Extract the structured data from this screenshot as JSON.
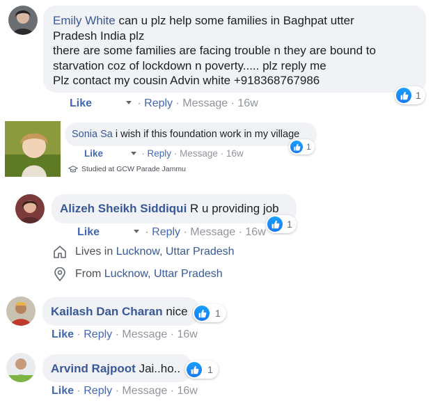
{
  "comments": [
    {
      "name": "Emily White",
      "text_line1": "can u plz help some families in Baghpat utter",
      "text_line2": "Pradesh India plz",
      "text_line3": "there are some families are facing trouble n they are bound to",
      "text_line4": "starvation coz of lockdown n poverty..... plz reply me",
      "text_line5": "Plz contact my cousin Advin white +918368767986",
      "reaction_count": "1",
      "like_label": "Like",
      "reply_label": "Reply",
      "message_label": "Message",
      "time": "16w"
    },
    {
      "name": "Sonia Sa",
      "text": "i wish if this foundation work in my village",
      "reaction_count": "1",
      "like_label": "Like",
      "reply_label": "Reply",
      "message_label": "Message",
      "time": "16w",
      "studied": "Studied at GCW Parade Jammu"
    },
    {
      "name": "Alizeh Sheikh Siddiqui",
      "text": "R u providing job",
      "reaction_count": "1",
      "like_label": "Like",
      "reply_label": "Reply",
      "message_label": "Message",
      "time": "16w",
      "lives_prefix": "Lives in",
      "lives_place": "Lucknow, Uttar Pradesh",
      "from_prefix": "From",
      "from_place": "Lucknow, Uttar Pradesh"
    },
    {
      "name": "Kailash Dan Charan",
      "text": "nice",
      "reaction_count": "1",
      "like_label": "Like",
      "reply_label": "Reply",
      "message_label": "Message",
      "time": "16w"
    },
    {
      "name": "Arvind Rajpoot",
      "text": "Jai..ho..",
      "reaction_count": "1",
      "like_label": "Like",
      "reply_label": "Reply",
      "message_label": "Message",
      "time": "16w"
    }
  ],
  "colors": {
    "name": "#385898",
    "like": "#4267b2",
    "bubble": "#f0f2f5",
    "muted": "#90949c",
    "reaction": "#1877f2"
  }
}
